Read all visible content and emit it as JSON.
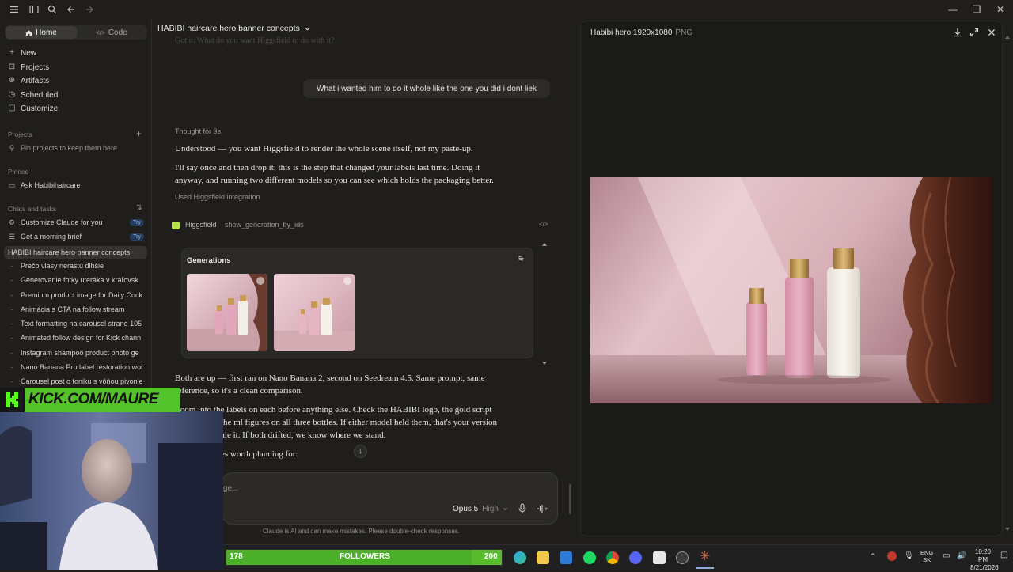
{
  "window": {
    "minimize": "—",
    "restore": "❐",
    "close": "✕"
  },
  "sidebar": {
    "tabs": [
      {
        "label": "Home",
        "icon": "home-icon"
      },
      {
        "label": "Code",
        "icon": "code-icon"
      }
    ],
    "nav": [
      {
        "label": "New",
        "icon": "plus-icon",
        "glyph": "+"
      },
      {
        "label": "Projects",
        "icon": "projects-icon",
        "glyph": "⊡"
      },
      {
        "label": "Artifacts",
        "icon": "artifacts-icon",
        "glyph": "⊕"
      },
      {
        "label": "Scheduled",
        "icon": "clock-icon",
        "glyph": "◷"
      },
      {
        "label": "Customize",
        "icon": "customize-icon",
        "glyph": "▢"
      }
    ],
    "projects_header": "Projects",
    "projects_add": "+",
    "projects_hint": "Pin projects to keep them here",
    "pinned_header": "Pinned",
    "pinned_item": "Ask Habibihaircare",
    "chats_header": "Chats and tasks",
    "chats": [
      {
        "label": "Customize Claude for you",
        "badge": "Try"
      },
      {
        "label": "Get a morning brief",
        "badge": "Try"
      },
      {
        "label": "HABIBI haircare hero banner concepts",
        "selected": true
      },
      {
        "label": "Prečo vlasy nerastú dlhšie"
      },
      {
        "label": "Generovanie fotky uteráka v kráľovsk"
      },
      {
        "label": "Premium product image for Daily Cock"
      },
      {
        "label": "Animácia s CTA na follow stream"
      },
      {
        "label": "Text formatting na carousel strane 105"
      },
      {
        "label": "Animated follow design for Kick chann"
      },
      {
        "label": "Instagram shampoo product photo ge"
      },
      {
        "label": "Nano Banana Pro label restoration wor"
      },
      {
        "label": "Carousel post o toniku s vôňou pivonie"
      }
    ]
  },
  "main": {
    "title": "HABIBI haircare hero banner concepts",
    "faded_line": "Got it. What do you want Higgsfield to do with it?",
    "user_message": "What i wanted him to do it whole like the one you did i dont liek",
    "thought": "Thought for 9s",
    "para1": "Understood — you want Higgsfield to render the whole scene itself, not my paste-up.",
    "para2_l1": "I'll say once and then drop it: this is the step that changed your labels last time. Doing it",
    "para2_l2": "anyway, and running two different models so you can see which holds the packaging better.",
    "used": "Used Higgsfield integration",
    "tool_name": "Higgsfield",
    "tool_call": "show_generation_by_ids",
    "generations_label": "Generations",
    "para3_l1": "Both are up — first ran on Nano Banana 2, second on Seedream 4.5. Same prompt, same",
    "para3_l2": "reference, so it's a clean comparison.",
    "para4_l1": "Zoom into the labels on each before anything else. Check the HABIBI logo, the gold script",
    "para4_l2": "the ml figures on all three bottles. If either model held them, that's your version",
    "para4_l3": "ale it. If both drifted, we know where we stand.",
    "para5": "es worth planning for:",
    "composer_placeholder": "ge...",
    "model": "Opus 5",
    "effort": "High",
    "disclaimer": "Claude is AI and can make mistakes. Please double-check responses."
  },
  "preview": {
    "title": "Habibi hero 1920x1080",
    "type": "PNG"
  },
  "overlay": {
    "kick_text": "KICK.COM/MAURE",
    "followers_count": "178",
    "followers_label": "FOLLOWERS",
    "followers_goal": "200"
  },
  "taskbar": {
    "lang": "ENG",
    "region": "SK",
    "time": "10:20 PM",
    "date": "8/21/2026"
  },
  "colors": {
    "accent_green": "#53c22b",
    "pink_bottle": "#dfa0b8",
    "gold_cap": "#c79b54"
  }
}
